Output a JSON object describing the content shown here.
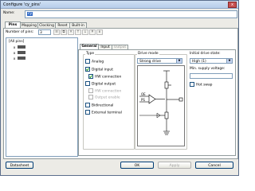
{
  "window": {
    "title": "Configure 'cy_pins'",
    "close": "x"
  },
  "name_field": {
    "label": "Name:",
    "value": "cy"
  },
  "main_tabs": [
    {
      "label": "Pins"
    },
    {
      "label": "Mapping"
    },
    {
      "label": "Clocking"
    },
    {
      "label": "Reset"
    },
    {
      "label": "Built-in"
    }
  ],
  "pins_toolbar": {
    "num_label": "Number of pins:",
    "num_value": "3"
  },
  "tree": {
    "root": "[All pins]",
    "items": [
      {
        "mark": "x"
      },
      {
        "mark": "x"
      },
      {
        "mark": "x"
      }
    ]
  },
  "sub_tabs": [
    {
      "label": "General"
    },
    {
      "label": "Input"
    },
    {
      "label": "Output"
    }
  ],
  "type_group": {
    "title": "Type",
    "analog": "Analog",
    "digital_input": "Digital input",
    "hw_connection": "HW connection",
    "digital_output": "Digital output",
    "hw_connection_out": "HW connection",
    "output_enable": "Output enable",
    "bidirectional": "Bidirectional",
    "external_terminal": "External terminal"
  },
  "drive_mode": {
    "title": "Drive mode",
    "value": "Strong drive",
    "schematic_labels": {
      "oe": "OE",
      "ps": "PS"
    }
  },
  "initial_state": {
    "title": "Initial drive state:",
    "value": "High (1)"
  },
  "min_voltage": {
    "title": "Min. supply voltage:",
    "value": ""
  },
  "hot_swap": {
    "label": "Hot swap"
  },
  "buttons": {
    "datasheet": "Datasheet",
    "ok": "OK",
    "apply": "Apply",
    "cancel": "Cancel"
  }
}
